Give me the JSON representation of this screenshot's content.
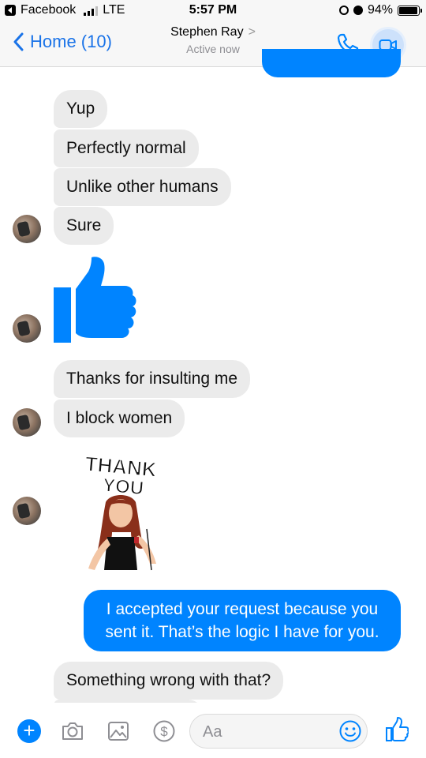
{
  "status_bar": {
    "back_app": "Facebook",
    "network": "LTE",
    "time": "5:57 PM",
    "battery_percent": "94%",
    "battery_level": 0.94
  },
  "nav": {
    "back_label": "Home (10)",
    "contact_name": "Stephen Ray",
    "chevron": ">",
    "status": "Active now",
    "accent": "#1a73e8"
  },
  "messages": [
    {
      "sender": "them",
      "type": "text",
      "text": "Yup"
    },
    {
      "sender": "them",
      "type": "text",
      "text": "Perfectly normal"
    },
    {
      "sender": "them",
      "type": "text",
      "text": "Unlike other humans"
    },
    {
      "sender": "them",
      "type": "text",
      "text": "Sure"
    },
    {
      "sender": "them",
      "type": "sticker",
      "sticker": "thumbs-up"
    },
    {
      "sender": "them",
      "type": "text",
      "text": "Thanks for insulting me"
    },
    {
      "sender": "them",
      "type": "text",
      "text": "I block women"
    },
    {
      "sender": "them",
      "type": "sticker",
      "sticker": "thank-you",
      "sticker_text": "THANK YOU"
    },
    {
      "sender": "me",
      "type": "text",
      "text": "I accepted your request because you sent it. That’s the logic I have for you."
    },
    {
      "sender": "them",
      "type": "text",
      "text": "Something wrong with that?"
    }
  ],
  "colors": {
    "outgoing_bubble": "#0084ff",
    "incoming_bubble": "#ebebeb",
    "messenger_blue": "#0084ff"
  },
  "composer": {
    "placeholder": "Aa",
    "icons": [
      "plus-icon",
      "camera-icon",
      "image-icon",
      "dollar-icon",
      "emoji-icon",
      "thumbs-up-icon"
    ]
  }
}
